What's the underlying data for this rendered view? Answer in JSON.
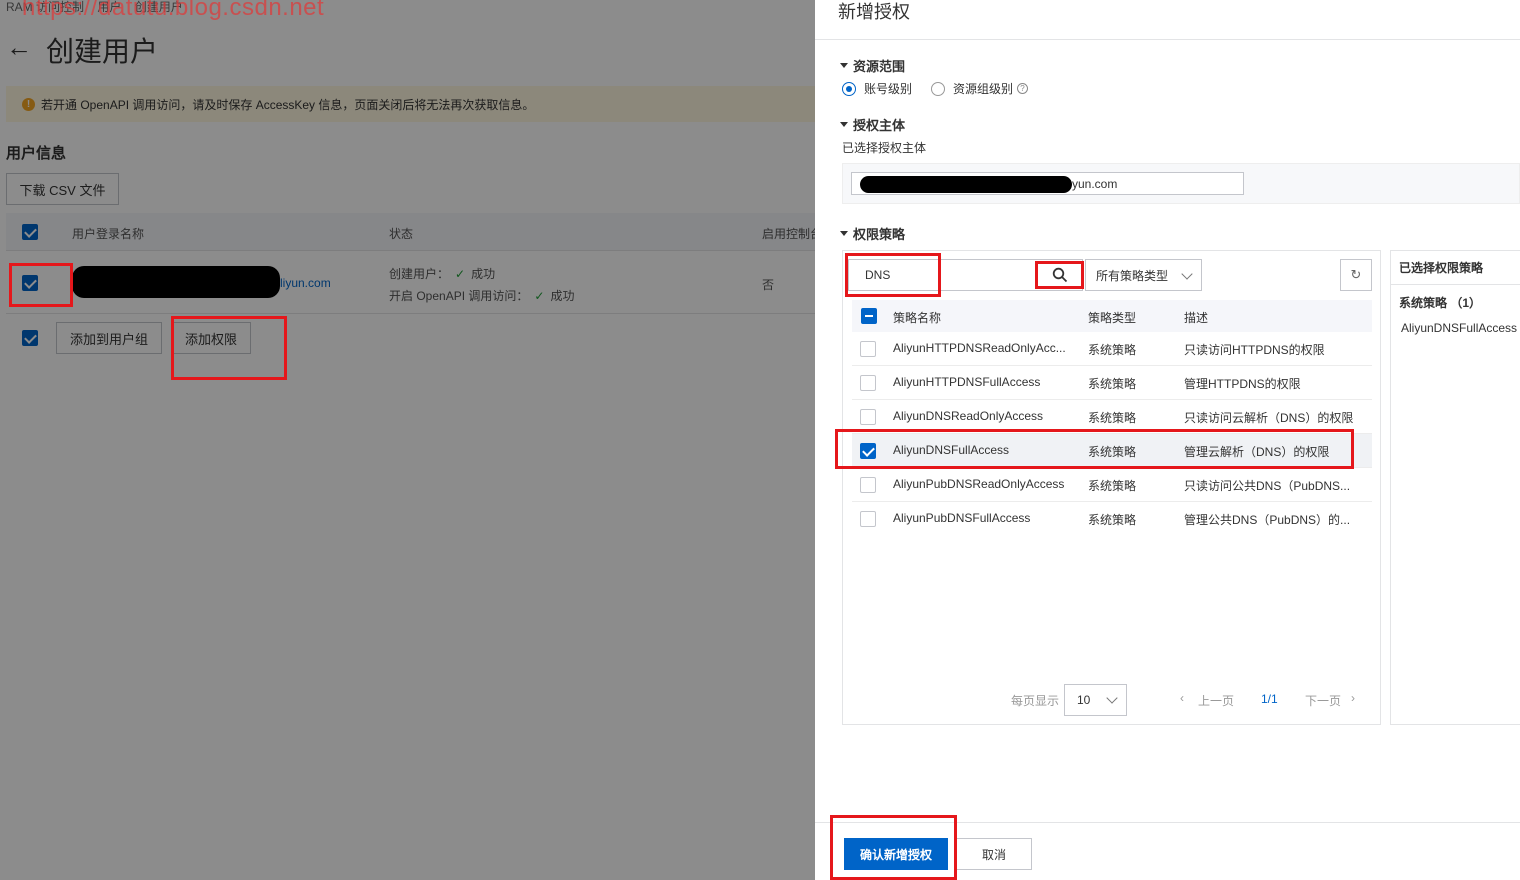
{
  "breadcrumb": [
    "RAM 访问控制",
    "用户",
    "创建用户"
  ],
  "watermark": "https://datutu.blog.csdn.net",
  "page": {
    "back_arrow": "←",
    "title": "创建用户",
    "notice_icon": "!",
    "notice": "若开通 OpenAPI 调用访问，请及时保存 AccessKey 信息，页面关闭后将无法再次获取信息。",
    "section_title": "用户信息",
    "download_csv": "下载 CSV 文件",
    "table": {
      "headers": [
        "用户登录名称",
        "状态",
        "启用控制台"
      ],
      "row": {
        "login_suffix": "liyun.com",
        "status_line1_label": "创建用户：",
        "status_line1_value": "成功",
        "status_line2_label": "开启 OpenAPI 调用访问：",
        "status_line2_value": "成功",
        "console": "否"
      }
    },
    "add_to_group": "添加到用户组",
    "add_permission": "添加权限"
  },
  "drawer": {
    "title": "新增授权",
    "scope": {
      "heading": "资源范围",
      "options": [
        "账号级别",
        "资源组级别"
      ],
      "selected": "账号级别"
    },
    "principal": {
      "heading": "授权主体",
      "selected_label": "已选择授权主体",
      "tag_suffix": "yun.com"
    },
    "policy": {
      "heading": "权限策略",
      "search_value": "DNS",
      "type_filter": "所有策略类型",
      "columns": [
        "策略名称",
        "策略类型",
        "描述"
      ],
      "rows": [
        {
          "name": "AliyunHTTPDNSReadOnlyAcc...",
          "type": "系统策略",
          "desc": "只读访问HTTPDNS的权限",
          "checked": false
        },
        {
          "name": "AliyunHTTPDNSFullAccess",
          "type": "系统策略",
          "desc": "管理HTTPDNS的权限",
          "checked": false
        },
        {
          "name": "AliyunDNSReadOnlyAccess",
          "type": "系统策略",
          "desc": "只读访问云解析（DNS）的权限",
          "checked": false
        },
        {
          "name": "AliyunDNSFullAccess",
          "type": "系统策略",
          "desc": "管理云解析（DNS）的权限",
          "checked": true
        },
        {
          "name": "AliyunPubDNSReadOnlyAccess",
          "type": "系统策略",
          "desc": "只读访问公共DNS（PubDNS...",
          "checked": false
        },
        {
          "name": "AliyunPubDNSFullAccess",
          "type": "系统策略",
          "desc": "管理公共DNS（PubDNS）的...",
          "checked": false
        }
      ],
      "pager": {
        "per_page_label": "每页显示",
        "per_page_value": "10",
        "prev": "上一页",
        "page": "1/1",
        "next": "下一页"
      }
    },
    "selected_policies": {
      "heading": "已选择权限策略",
      "group": "系统策略 （1）",
      "items": [
        "AliyunDNSFullAccess"
      ]
    },
    "confirm": "确认新增授权",
    "cancel": "取消"
  },
  "colors": {
    "primary": "#0064c8",
    "highlight": "#e5171b",
    "success": "#1e9e36",
    "warning": "#f5a623"
  }
}
